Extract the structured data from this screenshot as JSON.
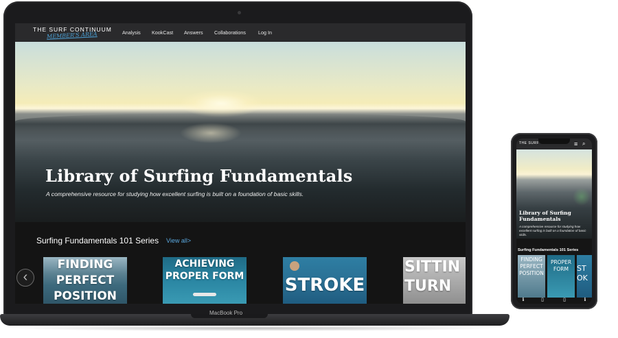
{
  "laptop": {
    "logo": {
      "main": "THE SURF CONTINUUM",
      "sub": "MEMBER'S AREA"
    },
    "nav": [
      {
        "label": "Analysis"
      },
      {
        "label": "KookCast"
      },
      {
        "label": "Answers"
      },
      {
        "label": "Collaborations"
      },
      {
        "label": "Log In"
      }
    ],
    "hero": {
      "title": "Library of Surfing Fundamentals",
      "subtitle": "A comprehensive resource for studying how excellent surfing is built on a foundation of basic skills."
    },
    "section": {
      "title": "Surfing Fundamentals 101 Series",
      "view_all": "View all>"
    },
    "carousel_prev": "‹",
    "cards": [
      {
        "lines": [
          "FINDING",
          "PERFECT",
          "POSITION"
        ]
      },
      {
        "lines": [
          "ACHIEVING",
          "PROPER FORM"
        ]
      },
      {
        "lines": [
          "STROKE"
        ]
      },
      {
        "lines": [
          "SITTIN",
          "TURN"
        ]
      }
    ],
    "brand": "MacBook Pro"
  },
  "phone": {
    "logo": "THE SURF",
    "menu_icon": "≡",
    "search_icon": "⌕",
    "hero": {
      "title": "Library of Surfing Fundamentals",
      "subtitle": "A comprehensive resource for studying how excellent surfing is built on a foundation of basic skills."
    },
    "section_title": "Surfing Fundamentals 101 Series",
    "cards": [
      {
        "lines": [
          "FINDING",
          "PERFECT",
          "POSITION"
        ]
      },
      {
        "lines": [
          "PROPER",
          "FORM"
        ]
      },
      {
        "lines": [
          "ST",
          "OK"
        ]
      }
    ],
    "tab_icons": [
      "ℹ",
      "▯",
      "▯",
      "ℹ"
    ]
  },
  "colors": {
    "accent": "#4da3d9",
    "nav_bg": "#2a2a2c",
    "page_bg": "#141414"
  }
}
